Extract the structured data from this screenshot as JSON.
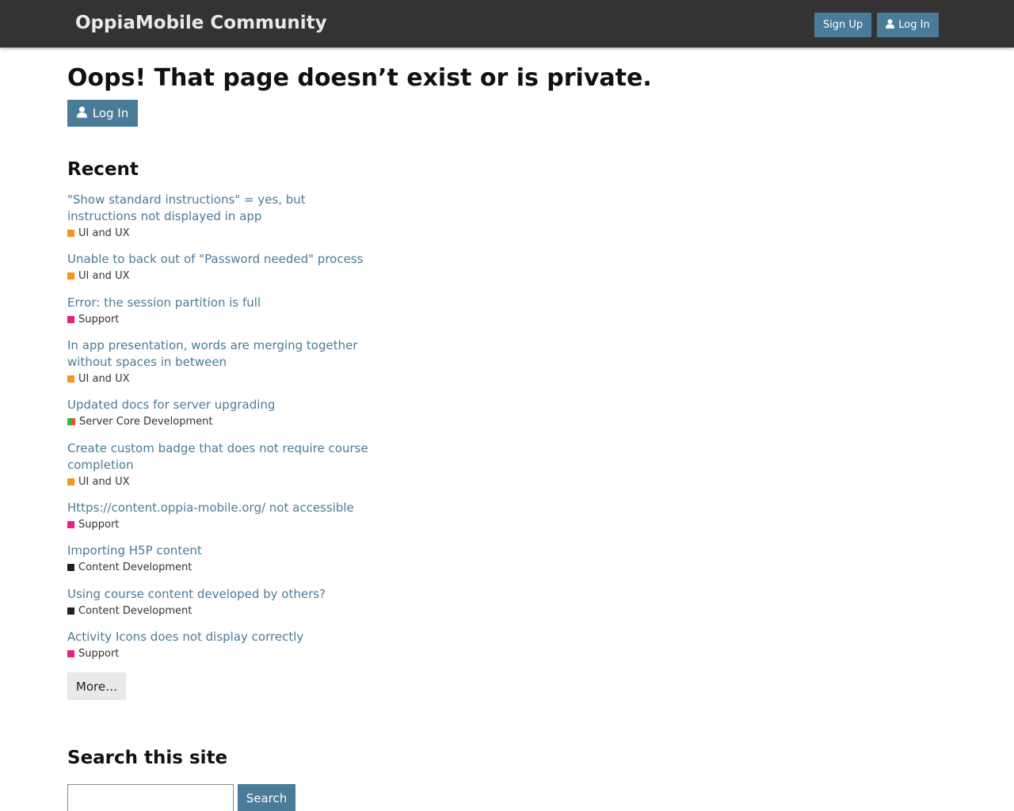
{
  "header": {
    "site_title": "OppiaMobile Community",
    "signup_label": "Sign Up",
    "login_label": "Log In"
  },
  "main": {
    "title": "Oops! That page doesn’t exist or is private.",
    "login_label": "Log In"
  },
  "recent": {
    "heading": "Recent",
    "topics": [
      {
        "title": "\"Show standard instructions\" = yes, but instructions not displayed in app",
        "category": "UI and UX",
        "color": "#f7941d"
      },
      {
        "title": "Unable to back out of \"Password needed\" process",
        "category": "UI and UX",
        "color": "#f7941d"
      },
      {
        "title": "Error: the session partition is full",
        "category": "Support",
        "color": "#e9217c"
      },
      {
        "title": "In app presentation, words are merging together without spaces in between",
        "category": "UI and UX",
        "color": "#f7941d"
      },
      {
        "title": "Updated docs for server upgrading",
        "category": "Server Core Development",
        "color": "#3ab54a",
        "color2": "#e45735"
      },
      {
        "title": "Create custom badge that does not require course completion",
        "category": "UI and UX",
        "color": "#f7941d"
      },
      {
        "title": "Https://content.oppia-mobile.org/ not accessible",
        "category": "Support",
        "color": "#e9217c"
      },
      {
        "title": "Importing H5P content",
        "category": "Content Development",
        "color": "#231f20"
      },
      {
        "title": "Using course content developed by others?",
        "category": "Content Development",
        "color": "#231f20"
      },
      {
        "title": "Activity Icons does not display correctly",
        "category": "Support",
        "color": "#e9217c"
      }
    ],
    "more_label": "More…"
  },
  "search": {
    "heading": "Search this site",
    "button_label": "Search",
    "input_value": ""
  },
  "icons": {
    "user": "user-icon"
  },
  "colors": {
    "header_bg": "#333333",
    "accent": "#4a7b98"
  }
}
